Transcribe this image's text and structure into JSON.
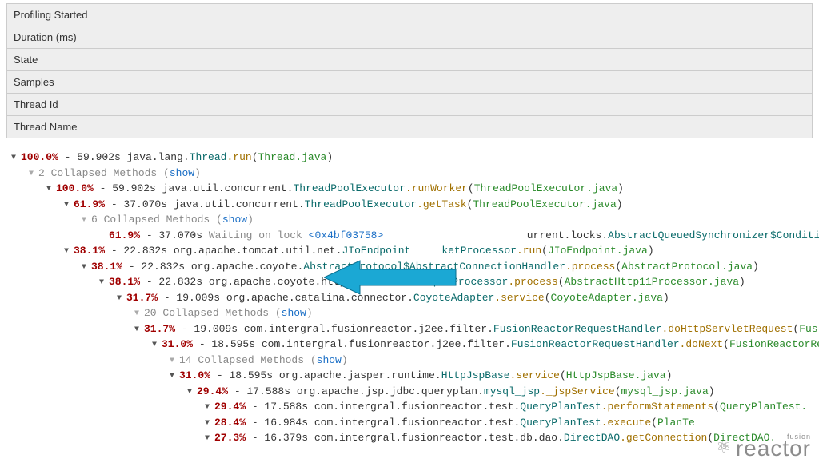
{
  "headers": {
    "profiling_started": "Profiling Started",
    "duration": "Duration (ms)",
    "state": "State",
    "samples": "Samples",
    "thread_id": "Thread Id",
    "thread_name": "Thread Name"
  },
  "collapsed_label_prefix": "Collapsed Methods",
  "show_label": "show",
  "waiting_label": "Waiting on lock",
  "lock_addr": "<0x4bf03758>",
  "tree": [
    {
      "indent": 0,
      "pct": "100.0%",
      "time": "59.902s",
      "pkg": "java.lang.",
      "cls": "Thread",
      "meth": ".run",
      "file": "Thread.java"
    },
    {
      "indent": 1,
      "collapsed": 2
    },
    {
      "indent": 2,
      "pct": "100.0%",
      "time": "59.902s",
      "pkg": "java.util.concurrent.",
      "cls": "ThreadPoolExecutor",
      "meth": ".runWorker",
      "file": "ThreadPoolExecutor.java"
    },
    {
      "indent": 3,
      "pct": "61.9%",
      "time": "37.070s",
      "pkg": "java.util.concurrent.",
      "cls": "ThreadPoolExecutor",
      "meth": ".getTask",
      "file": "ThreadPoolExecutor.java"
    },
    {
      "indent": 4,
      "collapsed": 6
    },
    {
      "indent": 5,
      "lock": true,
      "pct": "61.9%",
      "time": "37.070s",
      "tailpkg": "urrent.locks.",
      "tailcls": "AbstractQueuedSynchronizer$ConditionObjec"
    },
    {
      "indent": 3,
      "pct": "38.1%",
      "time": "22.832s",
      "pkg": "org.apache.tomcat.util.net.",
      "cls": "JIoEndpoint",
      "tail": "ketProcessor",
      "meth": ".run",
      "file": "JIoEndpoint.java"
    },
    {
      "indent": 4,
      "pct": "38.1%",
      "time": "22.832s",
      "pkg": "org.apache.coyote.",
      "cls": "AbstractProtocol$AbstractConnectionHandler",
      "meth": ".process",
      "file": "AbstractProtocol.java"
    },
    {
      "indent": 5,
      "pct": "38.1%",
      "time": "22.832s",
      "pkg": "org.apache.coyote.http11.",
      "cls": "AbstractHttp11Processor",
      "meth": ".process",
      "file": "AbstractHttp11Processor.java"
    },
    {
      "indent": 6,
      "pct": "31.7%",
      "time": "19.009s",
      "pkg": "org.apache.catalina.connector.",
      "cls": "CoyoteAdapter",
      "meth": ".service",
      "file": "CoyoteAdapter.java"
    },
    {
      "indent": 7,
      "collapsed": 20
    },
    {
      "indent": 7,
      "pct": "31.7%",
      "time": "19.009s",
      "pkg": "com.intergral.fusionreactor.j2ee.filter.",
      "cls": "FusionReactorRequestHandler",
      "meth": ".doHttpServletRequest",
      "file": "Fus"
    },
    {
      "indent": 8,
      "pct": "31.0%",
      "time": "18.595s",
      "pkg": "com.intergral.fusionreactor.j2ee.filter.",
      "cls": "FusionReactorRequestHandler",
      "meth": ".doNext",
      "file": "FusionReactorRe"
    },
    {
      "indent": 9,
      "collapsed": 14
    },
    {
      "indent": 9,
      "pct": "31.0%",
      "time": "18.595s",
      "pkg": "org.apache.jasper.runtime.",
      "cls": "HttpJspBase",
      "meth": ".service",
      "file": "HttpJspBase.java"
    },
    {
      "indent": 10,
      "pct": "29.4%",
      "time": "17.588s",
      "pkg": "org.apache.jsp.jdbc.queryplan.",
      "cls": "mysql_jsp",
      "meth": "._jspService",
      "file": "mysql_jsp.java"
    },
    {
      "indent": 11,
      "pct": "29.4%",
      "time": "17.588s",
      "pkg": "com.intergral.fusionreactor.test.",
      "cls": "QueryPlanTest",
      "meth": ".performStatements",
      "file": "QueryPlanTest."
    },
    {
      "indent": 11,
      "pct": "28.4%",
      "time": "16.984s",
      "pkg": "com.intergral.fusionreactor.test.",
      "cls": "QueryPlanTest",
      "meth": ".execute",
      "tail2": "PlanTe"
    },
    {
      "indent": 11,
      "pct": "27.3%",
      "time": "16.379s",
      "pkg": "com.intergral.fusionreactor.test.db.dao.",
      "cls": "DirectDAO",
      "meth": ".getConnection",
      "file": "DirectDAO."
    }
  ],
  "watermark": {
    "small": "fusion",
    "big": "reactor"
  }
}
